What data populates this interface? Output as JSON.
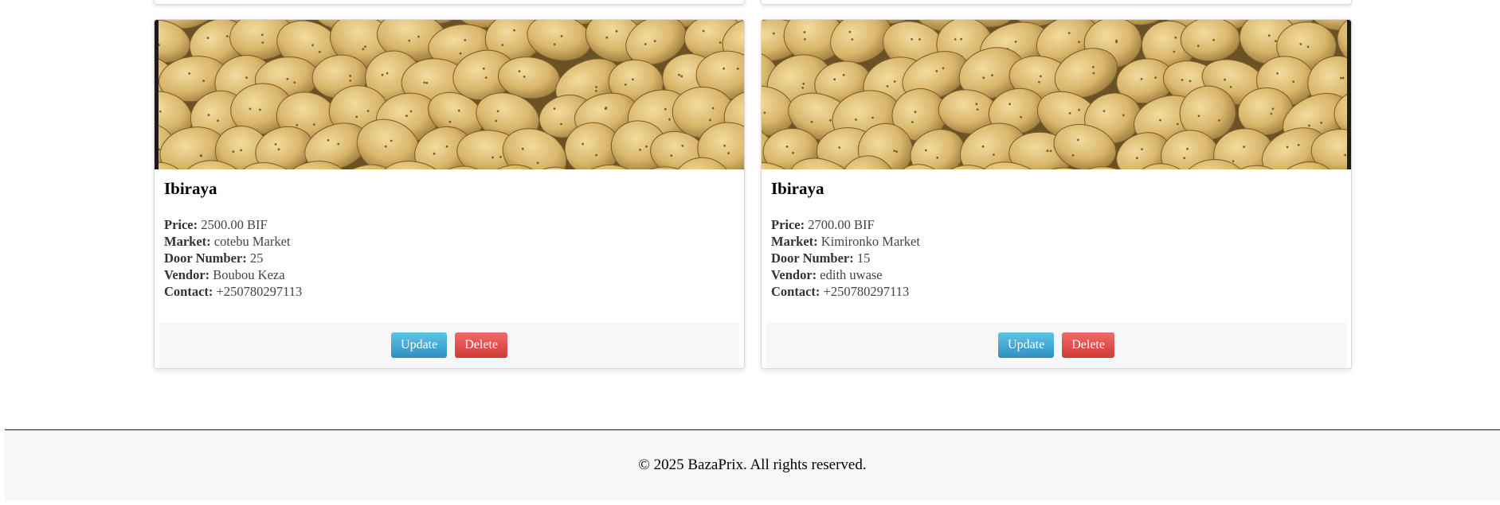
{
  "labels": {
    "price": "Price:",
    "market": "Market:",
    "door_number": "Door Number:",
    "vendor": "Vendor:",
    "contact": "Contact:"
  },
  "cards": [
    {
      "name": "Ibiraya",
      "price": "2500.00 BIF",
      "market": "cotebu Market",
      "door_number": "25",
      "vendor": "Boubou Keza",
      "contact": "+250780297113",
      "update_label": "Update",
      "delete_label": "Delete"
    },
    {
      "name": "Ibiraya",
      "price": "2700.00 BIF",
      "market": "Kimironko Market",
      "door_number": "15",
      "vendor": "edith uwase",
      "contact": "+250780297113",
      "update_label": "Update",
      "delete_label": "Delete"
    }
  ],
  "footer": {
    "copyright": "© 2025 BazaPrix. All rights reserved."
  },
  "colors": {
    "update_button": "#3aa4d6",
    "delete_button": "#e14d49",
    "footer_bg": "#f6f7f9"
  }
}
